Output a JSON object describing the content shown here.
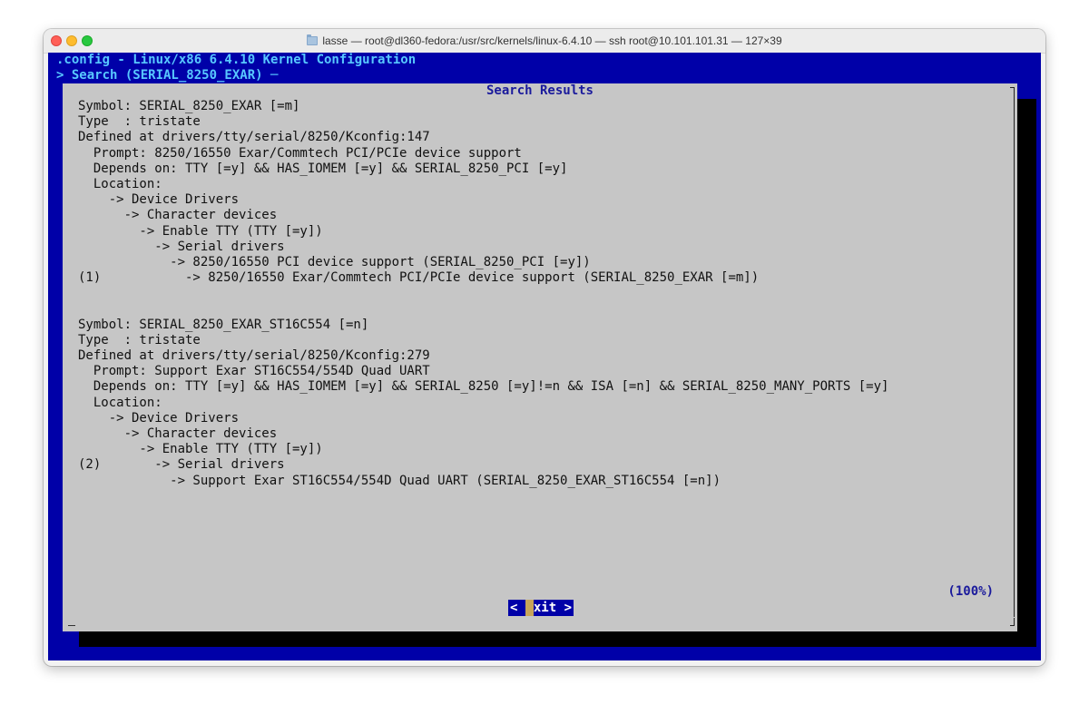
{
  "window": {
    "title": "lasse — root@dl360-fedora:/usr/src/kernels/linux-6.4.10 — ssh root@10.101.101.31 — 127×39"
  },
  "terminal": {
    "header_line": ".config - Linux/x86 6.4.10 Kernel Configuration",
    "breadcrumb": "> Search (SERIAL_8250_EXAR) ─"
  },
  "dialog": {
    "title": "Search Results",
    "percent": "(100%)",
    "exit_button": {
      "open": "< ",
      "hotkey": "E",
      "rest": "xit >"
    },
    "lines": [
      "Symbol: SERIAL_8250_EXAR [=m]",
      "Type  : tristate",
      "Defined at drivers/tty/serial/8250/Kconfig:147",
      "  Prompt: 8250/16550 Exar/Commtech PCI/PCIe device support",
      "  Depends on: TTY [=y] && HAS_IOMEM [=y] && SERIAL_8250_PCI [=y]",
      "  Location:",
      "    -> Device Drivers",
      "      -> Character devices",
      "        -> Enable TTY (TTY [=y])",
      "          -> Serial drivers",
      "            -> 8250/16550 PCI device support (SERIAL_8250_PCI [=y])",
      "(1)           -> 8250/16550 Exar/Commtech PCI/PCIe device support (SERIAL_8250_EXAR [=m])",
      "",
      "",
      "Symbol: SERIAL_8250_EXAR_ST16C554 [=n]",
      "Type  : tristate",
      "Defined at drivers/tty/serial/8250/Kconfig:279",
      "  Prompt: Support Exar ST16C554/554D Quad UART",
      "  Depends on: TTY [=y] && HAS_IOMEM [=y] && SERIAL_8250 [=y]!=n && ISA [=n] && SERIAL_8250_MANY_PORTS [=y]",
      "  Location:",
      "    -> Device Drivers",
      "      -> Character devices",
      "        -> Enable TTY (TTY [=y])",
      "(2)       -> Serial drivers",
      "            -> Support Exar ST16C554/554D Quad UART (SERIAL_8250_EXAR_ST16C554 [=n])"
    ]
  },
  "colors": {
    "terminal_bg": "#0000a8",
    "dialog_bg": "#c6c6c6",
    "header_text": "#58c8ff",
    "title_text": "#1a1a9c",
    "button_bg": "#0000a8",
    "hotkey_bg": "#c6a45a"
  }
}
